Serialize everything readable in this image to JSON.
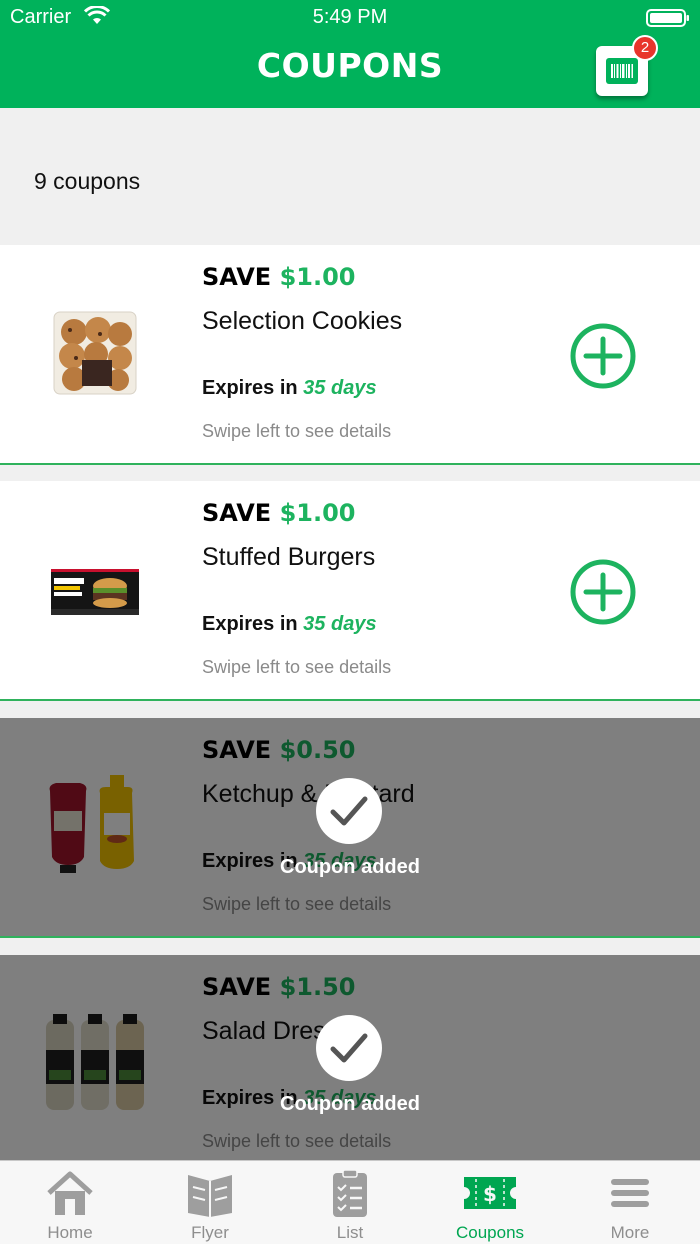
{
  "status_bar": {
    "carrier": "Carrier",
    "time": "5:49 PM"
  },
  "header": {
    "title": "COUPONS",
    "cart_badge": "2"
  },
  "summary": {
    "count_label": "9 coupons"
  },
  "coupons": [
    {
      "save_word": "SAVE",
      "amount": "$1.00",
      "name": "Selection Cookies",
      "expires_prefix": "Expires in",
      "expires_days": "35 days",
      "hint": "Swipe left to see details",
      "added": false
    },
    {
      "save_word": "SAVE",
      "amount": "$1.00",
      "name": "Stuffed Burgers",
      "expires_prefix": "Expires in",
      "expires_days": "35 days",
      "hint": "Swipe left to see details",
      "added": false
    },
    {
      "save_word": "SAVE",
      "amount": "$0.50",
      "name": "Ketchup & Mustard",
      "expires_prefix": "Expires in",
      "expires_days": "35 days",
      "hint": "Swipe left to see details",
      "added": true,
      "added_label": "Coupon added"
    },
    {
      "save_word": "SAVE",
      "amount": "$1.50",
      "name": "Salad Dressing",
      "expires_prefix": "Expires in",
      "expires_days": "35 days",
      "hint": "Swipe left to see details",
      "added": true,
      "added_label": "Coupon added"
    }
  ],
  "tabs": [
    {
      "label": "Home",
      "icon": "home-icon"
    },
    {
      "label": "Flyer",
      "icon": "flyer-icon"
    },
    {
      "label": "List",
      "icon": "list-icon"
    },
    {
      "label": "Coupons",
      "icon": "coupon-icon",
      "active": true
    },
    {
      "label": "More",
      "icon": "menu-icon"
    }
  ],
  "colors": {
    "brand_green": "#00b25b",
    "accent_green": "#1db35f",
    "badge_red": "#e8352c"
  }
}
